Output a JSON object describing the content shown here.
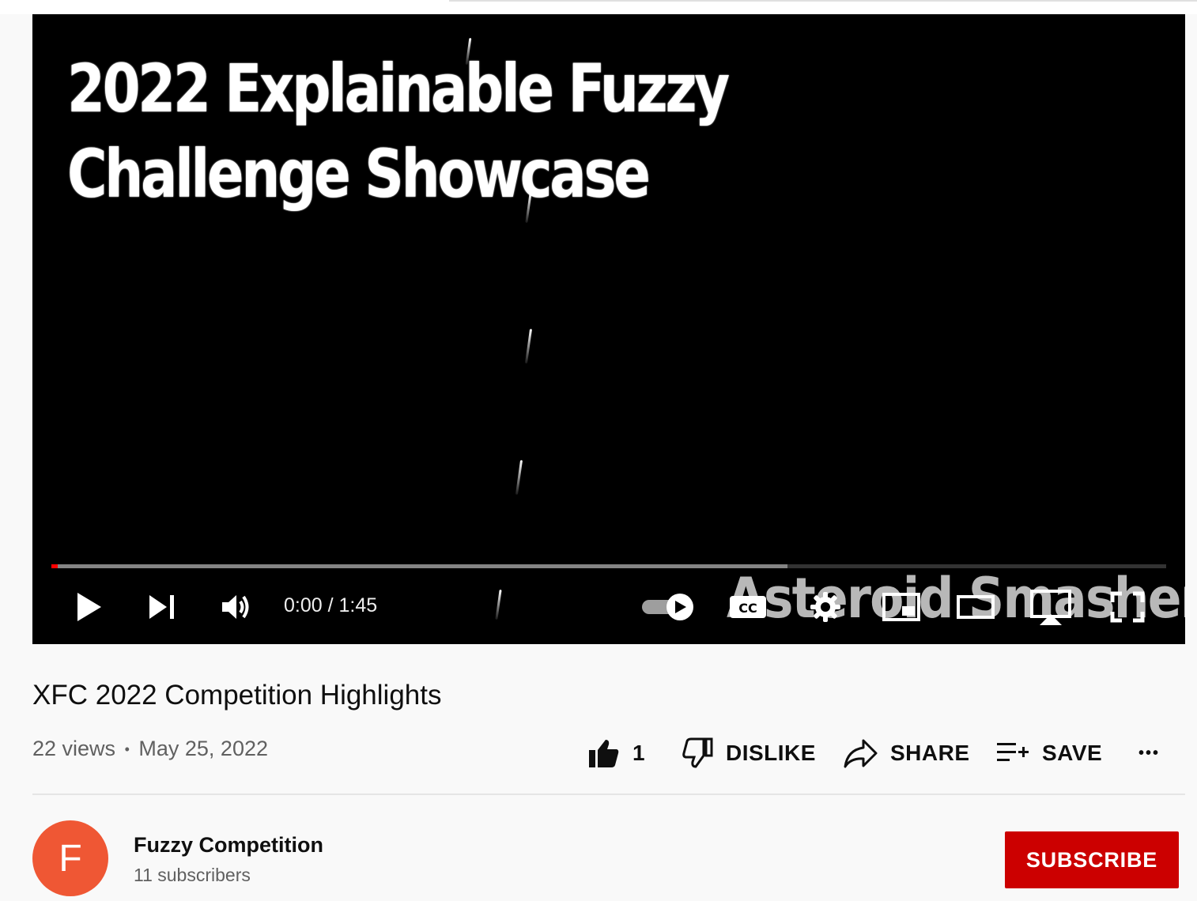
{
  "player": {
    "frame_title_line1": "2022 Explainable Fuzzy",
    "frame_title_line2": "Challenge Showcase",
    "watermark": "Asteroid Smasher",
    "current_time": "0:00",
    "time_separator": "/",
    "duration": "1:45",
    "played_fraction": 0,
    "buffered_fraction": 0.66,
    "controls": {
      "play": "play-icon",
      "next": "next-icon",
      "volume": "volume-icon",
      "autoplay": "autoplay-toggle-icon",
      "captions": "cc-icon",
      "settings": "gear-icon",
      "miniplayer": "miniplayer-icon",
      "theater": "theater-icon",
      "cast": "cast-icon",
      "fullscreen": "fullscreen-icon"
    },
    "accent_color": "#ff0000"
  },
  "video": {
    "title": "XFC 2022 Competition Highlights",
    "views": "22 views",
    "dot": "•",
    "date": "May 25, 2022"
  },
  "actions": {
    "like_count": "1",
    "dislike_label": "DISLIKE",
    "share_label": "SHARE",
    "save_label": "SAVE",
    "more_label": "•••"
  },
  "channel": {
    "avatar_letter": "F",
    "name": "Fuzzy Competition",
    "subscribers": "11 subscribers",
    "subscribe_label": "SUBSCRIBE",
    "avatar_color": "#ef5734",
    "subscribe_color": "#cc0000"
  }
}
